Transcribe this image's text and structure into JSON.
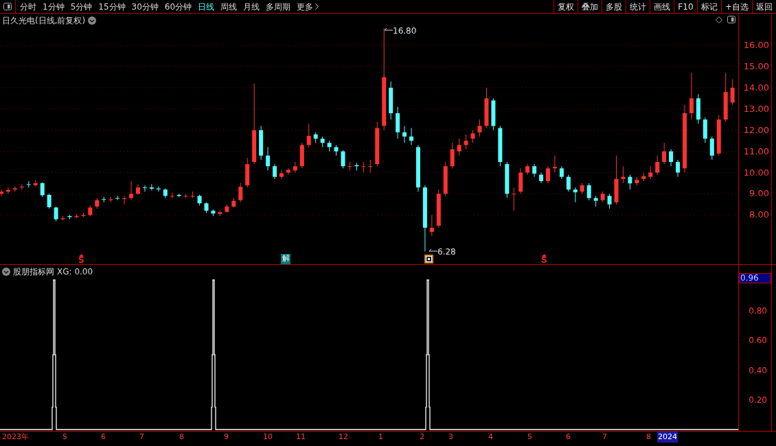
{
  "toolbar": {
    "periods": [
      {
        "label": "分时",
        "selected": false
      },
      {
        "label": "1分钟",
        "selected": false
      },
      {
        "label": "5分钟",
        "selected": false
      },
      {
        "label": "15分钟",
        "selected": false
      },
      {
        "label": "30分钟",
        "selected": false
      },
      {
        "label": "60分钟",
        "selected": false
      },
      {
        "label": "日线",
        "selected": true
      },
      {
        "label": "周线",
        "selected": false
      },
      {
        "label": "月线",
        "selected": false
      },
      {
        "label": "多周期",
        "selected": false
      }
    ],
    "more": "更多",
    "actions": [
      "复权",
      "叠加",
      "多股",
      "统计",
      "画线",
      "F10",
      "标记",
      "+自选",
      "返回"
    ]
  },
  "price_pane": {
    "title": "日久光电(日线,前复权)",
    "chart_data": {
      "type": "candlestick",
      "ylim": [
        -2.18,
        17.49
      ],
      "grid": true,
      "yticks": [
        {
          "value": 16,
          "label": "16.00"
        },
        {
          "value": 15,
          "label": "15.00"
        },
        {
          "value": 14,
          "label": "14.00"
        },
        {
          "value": 13,
          "label": "13.00"
        },
        {
          "value": 12,
          "label": "12.00"
        },
        {
          "value": 11,
          "label": "11.00"
        },
        {
          "value": 10,
          "label": "10.00"
        },
        {
          "value": 9,
          "label": "9.00"
        },
        {
          "value": 8,
          "label": "8.00"
        }
      ],
      "ohlc": [
        [
          9.0,
          9.2,
          8.9,
          9.1
        ],
        [
          9.1,
          9.3,
          9.0,
          9.18
        ],
        [
          9.2,
          9.35,
          9.1,
          9.26
        ],
        [
          9.3,
          9.45,
          9.2,
          9.34
        ],
        [
          9.45,
          9.6,
          9.3,
          9.42
        ],
        [
          9.4,
          9.65,
          9.35,
          9.5
        ],
        [
          9.5,
          9.55,
          8.85,
          8.93
        ],
        [
          8.95,
          9.0,
          8.3,
          8.37
        ],
        [
          8.35,
          8.4,
          7.7,
          7.8
        ],
        [
          7.8,
          7.95,
          7.75,
          7.85
        ],
        [
          7.95,
          8.0,
          7.8,
          7.9
        ],
        [
          7.9,
          8.05,
          7.85,
          7.95
        ],
        [
          7.95,
          8.1,
          7.9,
          8.0
        ],
        [
          8.0,
          8.45,
          7.95,
          8.35
        ],
        [
          8.4,
          8.8,
          8.3,
          8.7
        ],
        [
          8.75,
          8.85,
          8.6,
          8.72
        ],
        [
          8.7,
          8.85,
          8.6,
          8.74
        ],
        [
          8.8,
          8.9,
          8.7,
          8.77
        ],
        [
          8.75,
          8.9,
          8.5,
          8.79
        ],
        [
          8.8,
          9.6,
          8.7,
          9.0
        ],
        [
          9.0,
          9.45,
          8.95,
          9.3
        ],
        [
          9.3,
          9.4,
          9.1,
          9.27
        ],
        [
          9.3,
          9.45,
          9.15,
          9.24
        ],
        [
          9.25,
          9.35,
          9.1,
          9.21
        ],
        [
          9.2,
          9.25,
          8.8,
          8.9
        ],
        [
          8.9,
          9.05,
          8.8,
          8.9
        ],
        [
          8.95,
          9.0,
          8.85,
          8.9
        ],
        [
          8.9,
          9.0,
          8.8,
          8.9
        ],
        [
          8.9,
          9.1,
          8.8,
          8.9
        ],
        [
          8.9,
          8.95,
          8.45,
          8.55
        ],
        [
          8.55,
          8.6,
          8.1,
          8.2
        ],
        [
          8.2,
          8.25,
          7.95,
          8.07
        ],
        [
          8.05,
          8.2,
          7.95,
          8.13
        ],
        [
          8.15,
          8.5,
          8.1,
          8.4
        ],
        [
          8.4,
          8.8,
          8.35,
          8.67
        ],
        [
          8.7,
          9.5,
          8.6,
          9.33
        ],
        [
          9.4,
          10.7,
          9.3,
          10.4
        ],
        [
          10.5,
          14.2,
          10.4,
          12.0
        ],
        [
          12.0,
          12.2,
          10.6,
          10.8
        ],
        [
          10.8,
          11.2,
          10.1,
          10.3
        ],
        [
          10.3,
          10.4,
          9.7,
          9.8
        ],
        [
          9.8,
          10.1,
          9.7,
          9.97
        ],
        [
          10.0,
          10.2,
          9.9,
          10.13
        ],
        [
          10.1,
          10.5,
          10.0,
          10.3
        ],
        [
          10.3,
          11.4,
          10.2,
          11.3
        ],
        [
          11.3,
          12.3,
          11.2,
          11.73
        ],
        [
          11.8,
          11.9,
          11.4,
          11.6
        ],
        [
          11.6,
          11.7,
          11.2,
          11.4
        ],
        [
          11.4,
          11.5,
          11.0,
          11.2
        ],
        [
          11.2,
          11.3,
          10.8,
          11.0
        ],
        [
          11.0,
          11.05,
          10.2,
          10.3
        ],
        [
          10.3,
          10.5,
          10.1,
          10.3
        ],
        [
          10.35,
          10.45,
          10.1,
          10.3
        ],
        [
          10.3,
          10.5,
          10.0,
          10.3
        ],
        [
          10.3,
          10.6,
          10.0,
          10.3
        ],
        [
          10.4,
          12.4,
          10.3,
          12.1
        ],
        [
          12.2,
          16.8,
          12.0,
          14.5
        ],
        [
          14.0,
          14.3,
          12.5,
          12.8
        ],
        [
          12.8,
          13.1,
          11.6,
          11.9
        ],
        [
          11.9,
          12.2,
          11.4,
          11.7
        ],
        [
          11.7,
          12.1,
          11.3,
          11.5
        ],
        [
          11.2,
          11.3,
          9.1,
          9.3
        ],
        [
          9.3,
          9.4,
          6.28,
          7.4
        ],
        [
          7.2,
          8.0,
          7.0,
          7.4
        ],
        [
          7.5,
          9.2,
          7.4,
          9.0
        ],
        [
          9.0,
          10.5,
          8.9,
          10.3
        ],
        [
          10.3,
          11.4,
          10.2,
          11.1
        ],
        [
          11.0,
          11.6,
          10.8,
          11.3
        ],
        [
          11.3,
          11.8,
          11.1,
          11.5
        ],
        [
          11.6,
          12.0,
          11.4,
          11.85
        ],
        [
          11.9,
          12.5,
          11.7,
          12.2
        ],
        [
          12.2,
          14.0,
          12.1,
          13.5
        ],
        [
          13.4,
          13.5,
          12.0,
          12.2
        ],
        [
          12.1,
          12.2,
          10.3,
          10.5
        ],
        [
          10.4,
          10.5,
          8.8,
          9.0
        ],
        [
          9.0,
          9.3,
          8.2,
          9.0
        ],
        [
          9.1,
          10.2,
          9.0,
          10.0
        ],
        [
          10.0,
          10.4,
          9.9,
          10.3
        ],
        [
          10.3,
          10.4,
          9.8,
          9.95
        ],
        [
          9.9,
          10.0,
          9.5,
          9.6
        ],
        [
          9.6,
          10.3,
          9.5,
          10.2
        ],
        [
          10.2,
          10.8,
          10.0,
          10.27
        ],
        [
          10.2,
          10.3,
          9.7,
          9.8
        ],
        [
          9.8,
          9.9,
          9.1,
          9.2
        ],
        [
          9.2,
          9.3,
          8.6,
          9.07
        ],
        [
          9.1,
          9.5,
          9.0,
          9.4
        ],
        [
          9.4,
          9.5,
          8.7,
          8.8
        ],
        [
          8.8,
          8.9,
          8.4,
          8.67
        ],
        [
          8.7,
          9.1,
          8.6,
          9.0
        ],
        [
          8.9,
          9.0,
          8.3,
          8.5
        ],
        [
          8.6,
          10.8,
          8.5,
          9.7
        ],
        [
          9.7,
          10.3,
          9.5,
          9.8
        ],
        [
          9.8,
          9.9,
          9.2,
          9.49
        ],
        [
          9.5,
          9.8,
          9.4,
          9.66
        ],
        [
          9.7,
          10.0,
          9.6,
          9.83
        ],
        [
          9.8,
          10.3,
          9.7,
          10.0
        ],
        [
          10.0,
          10.8,
          9.9,
          10.5
        ],
        [
          10.5,
          11.4,
          10.4,
          11.0
        ],
        [
          11.0,
          11.1,
          10.3,
          10.5
        ],
        [
          10.5,
          10.6,
          9.8,
          10.0
        ],
        [
          10.2,
          13.2,
          10.0,
          12.8
        ],
        [
          12.8,
          14.7,
          12.5,
          13.5
        ],
        [
          13.5,
          13.7,
          12.3,
          12.5
        ],
        [
          12.5,
          12.6,
          11.4,
          11.6
        ],
        [
          11.6,
          11.7,
          10.6,
          10.8
        ],
        [
          10.9,
          12.7,
          10.8,
          12.5
        ],
        [
          12.5,
          14.7,
          12.4,
          13.8
        ],
        [
          13.3,
          14.4,
          13.2,
          14.0
        ]
      ]
    },
    "annotations": [
      {
        "kind": "high",
        "label": "16.80"
      },
      {
        "kind": "low",
        "label": "6.28"
      }
    ],
    "markers": [
      {
        "kind": "sell",
        "label": "S"
      },
      {
        "kind": "tag",
        "label": "解"
      },
      {
        "kind": "box"
      },
      {
        "kind": "sell",
        "label": "S"
      }
    ]
  },
  "indicator_pane": {
    "title": "股朋指标网",
    "reading": "XG: 0.00",
    "current": "0.96",
    "y_labels": [
      "0.80",
      "0.60",
      "0.40",
      "0.20"
    ]
  },
  "date_axis": [
    {
      "label": "2023年",
      "selected": false
    },
    {
      "label": "5",
      "selected": false
    },
    {
      "label": "6",
      "selected": false
    },
    {
      "label": "7",
      "selected": false
    },
    {
      "label": "8",
      "selected": false
    },
    {
      "label": "9",
      "selected": false
    },
    {
      "label": "10",
      "selected": false
    },
    {
      "label": "11",
      "selected": false
    },
    {
      "label": "12",
      "selected": false
    },
    {
      "label": "1",
      "selected": false
    },
    {
      "label": "2",
      "selected": false
    },
    {
      "label": "3",
      "selected": false
    },
    {
      "label": "4",
      "selected": false
    },
    {
      "label": "5",
      "selected": false
    },
    {
      "label": "6",
      "selected": false
    },
    {
      "label": "7",
      "selected": false
    },
    {
      "label": "8",
      "selected": false
    },
    {
      "label": "2024",
      "selected": true
    }
  ]
}
